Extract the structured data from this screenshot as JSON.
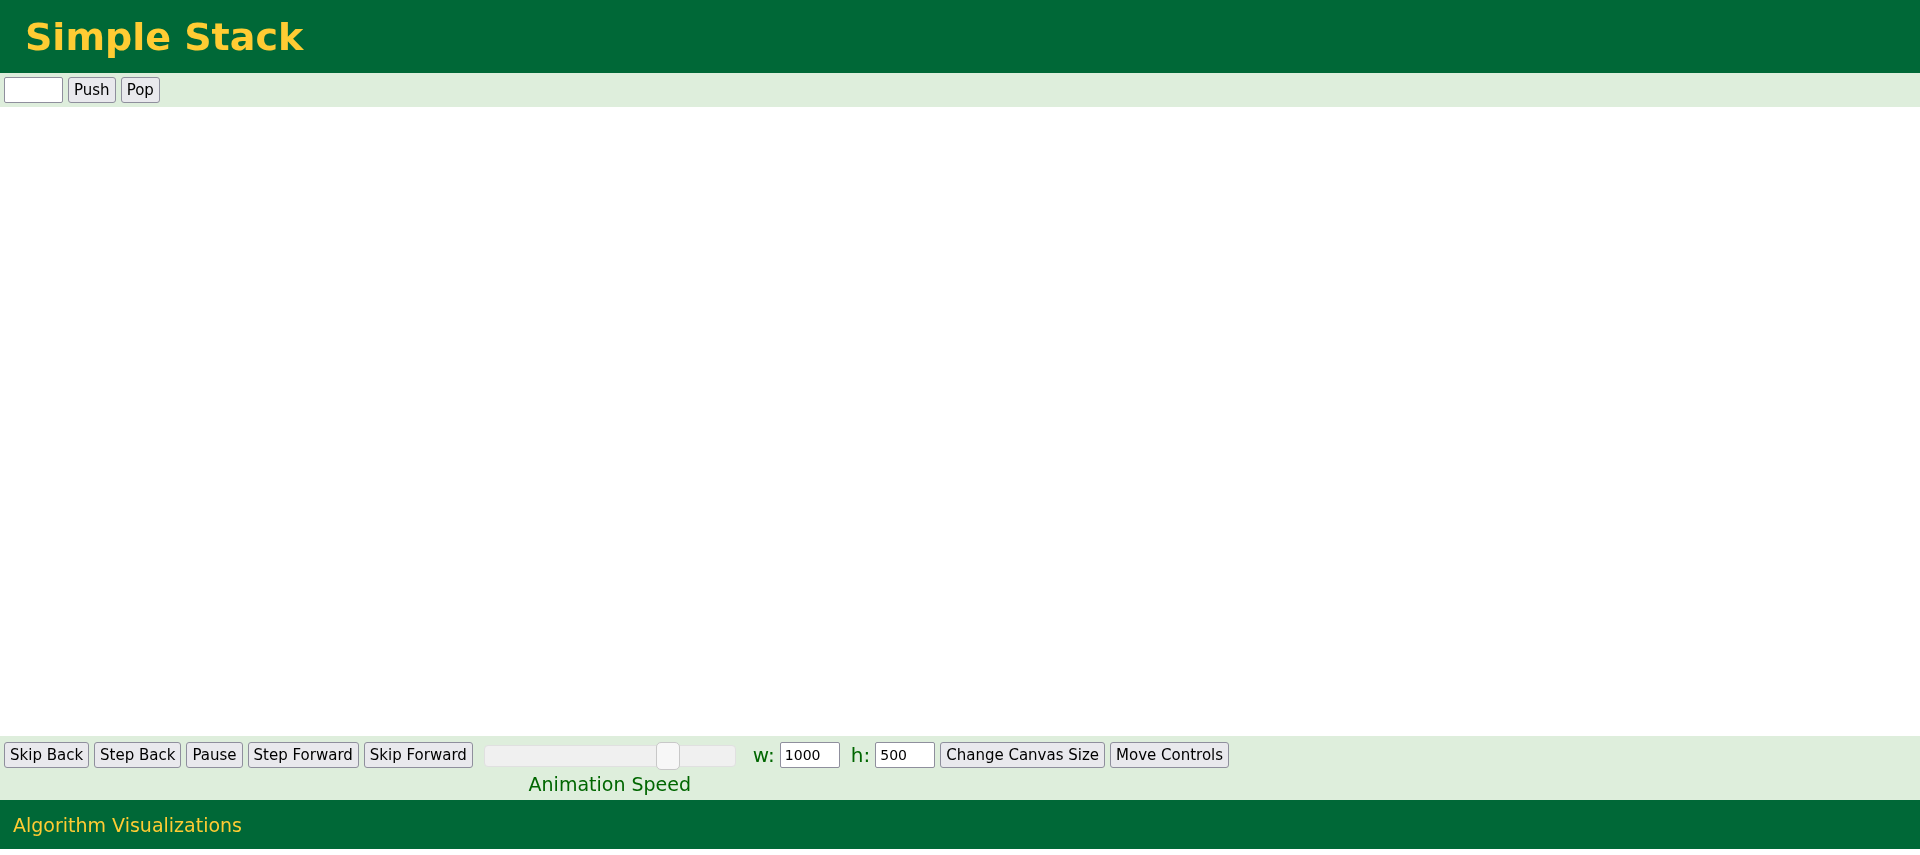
{
  "header": {
    "title": "Simple Stack"
  },
  "controls": {
    "buttons": [
      "Push",
      "Pop"
    ]
  },
  "animation_controls": {
    "buttons": [
      "Skip Back",
      "Step Back",
      "Pause",
      "Step Forward",
      "Skip Forward"
    ],
    "speed_slider": {
      "level": 0.75,
      "label": "Animation Speed"
    },
    "width_label": "w:",
    "width_value": "1000",
    "height_label": "h:",
    "height_value": "500",
    "size_buttons": [
      "Change Canvas Size",
      "Move Controls"
    ]
  },
  "footer": {
    "text": "Algorithm Visualizations"
  }
}
